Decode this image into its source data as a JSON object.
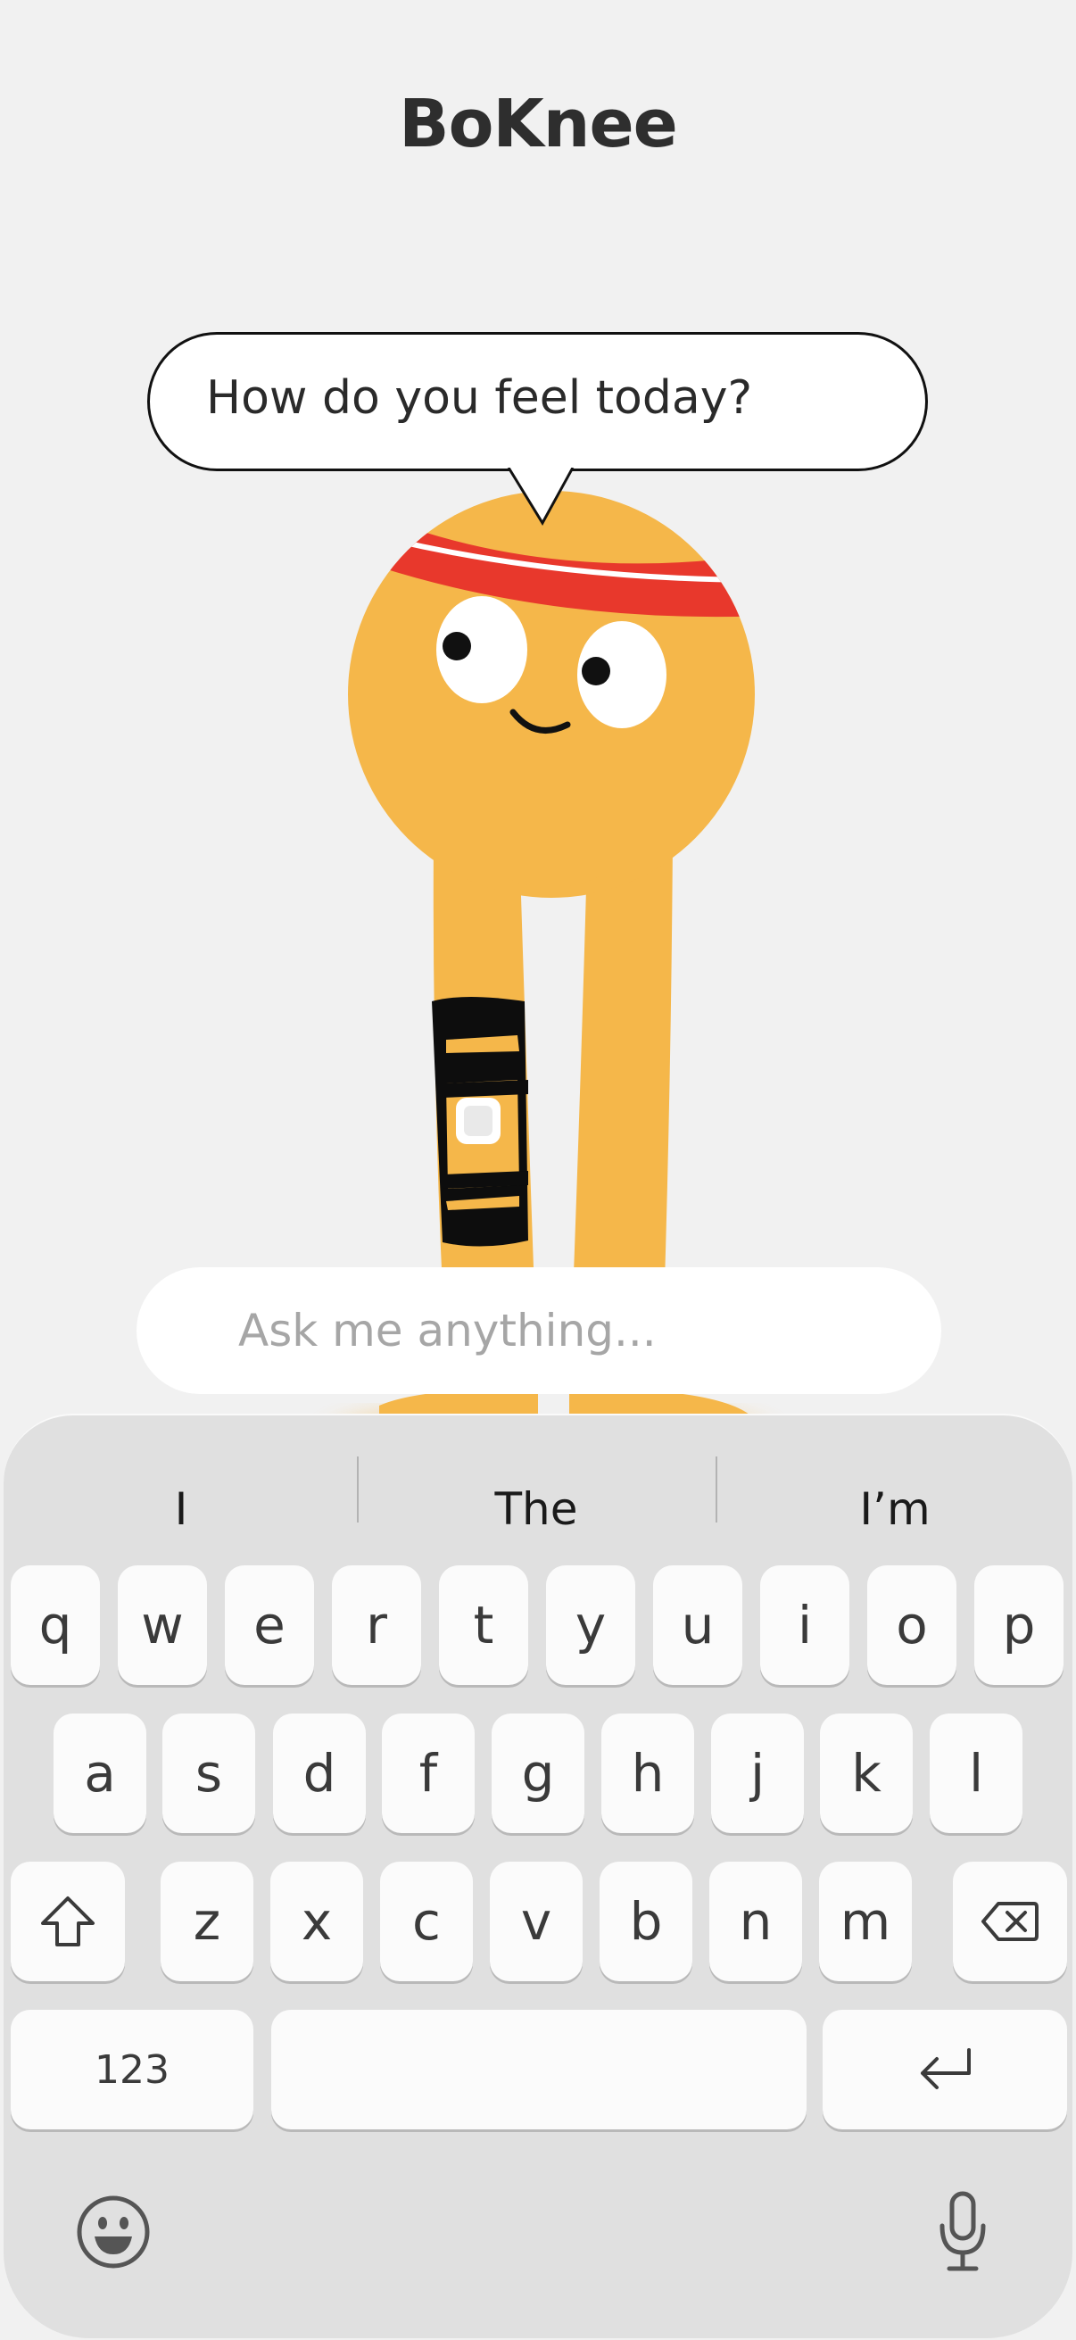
{
  "app": {
    "title": "BoKnee"
  },
  "assistant": {
    "greeting": "How do you feel today?"
  },
  "chat": {
    "placeholder": "Ask me anything..."
  },
  "keyboard": {
    "suggestions": [
      "I",
      "The",
      "I’m"
    ],
    "row1": [
      "q",
      "w",
      "e",
      "r",
      "t",
      "y",
      "u",
      "i",
      "o",
      "p"
    ],
    "row2": [
      "a",
      "s",
      "d",
      "f",
      "g",
      "h",
      "j",
      "k",
      "l"
    ],
    "row3": [
      "z",
      "x",
      "c",
      "v",
      "b",
      "n",
      "m"
    ],
    "numbers_label": "123",
    "shift_icon": "shift-arrow-icon",
    "delete_icon": "backspace-icon",
    "return_icon": "return-arrow-icon",
    "emoji_icon": "smiley-face-icon",
    "dictation_icon": "microphone-icon"
  },
  "colors": {
    "background": "#f1f1f1",
    "mascot_body": "#f5b74a",
    "headband": "#e8382c",
    "knee_brace": "#0d0d0d",
    "keyboard_bg": "#e0e0e0",
    "key_bg": "#fbfbfb"
  }
}
